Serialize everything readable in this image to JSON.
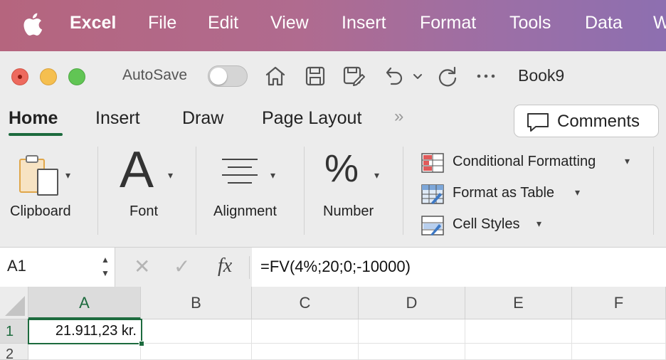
{
  "menubar": {
    "app": "Excel",
    "items": [
      "File",
      "Edit",
      "View",
      "Insert",
      "Format",
      "Tools",
      "Data",
      "W"
    ]
  },
  "titlebar": {
    "autosave_label": "AutoSave",
    "autosave_on": false,
    "document_title": "Book9"
  },
  "tabs": {
    "items": [
      "Home",
      "Insert",
      "Draw",
      "Page Layout"
    ],
    "active": "Home",
    "more": "»",
    "comments_label": "Comments"
  },
  "ribbon": {
    "clipboard_label": "Clipboard",
    "font_glyph": "A",
    "font_label": "Font",
    "alignment_label": "Alignment",
    "number_glyph": "%",
    "number_label": "Number",
    "conditional_formatting": "Conditional Formatting",
    "format_as_table": "Format as Table",
    "cell_styles": "Cell Styles"
  },
  "formula_bar": {
    "name_box": "A1",
    "cancel_glyph": "✕",
    "enter_glyph": "✓",
    "fx": "fx",
    "formula": "=FV(4%;20;0;-10000)"
  },
  "grid": {
    "columns": [
      "A",
      "B",
      "C",
      "D",
      "E",
      "F"
    ],
    "rows": [
      "1",
      "2"
    ],
    "selected_cell": "A1",
    "cells": {
      "A1": "21.911,23 kr."
    }
  },
  "colors": {
    "accent": "#1d6b3e",
    "menubar_gradient_start": "#b5657e",
    "menubar_gradient_end": "#8d6fb0"
  }
}
